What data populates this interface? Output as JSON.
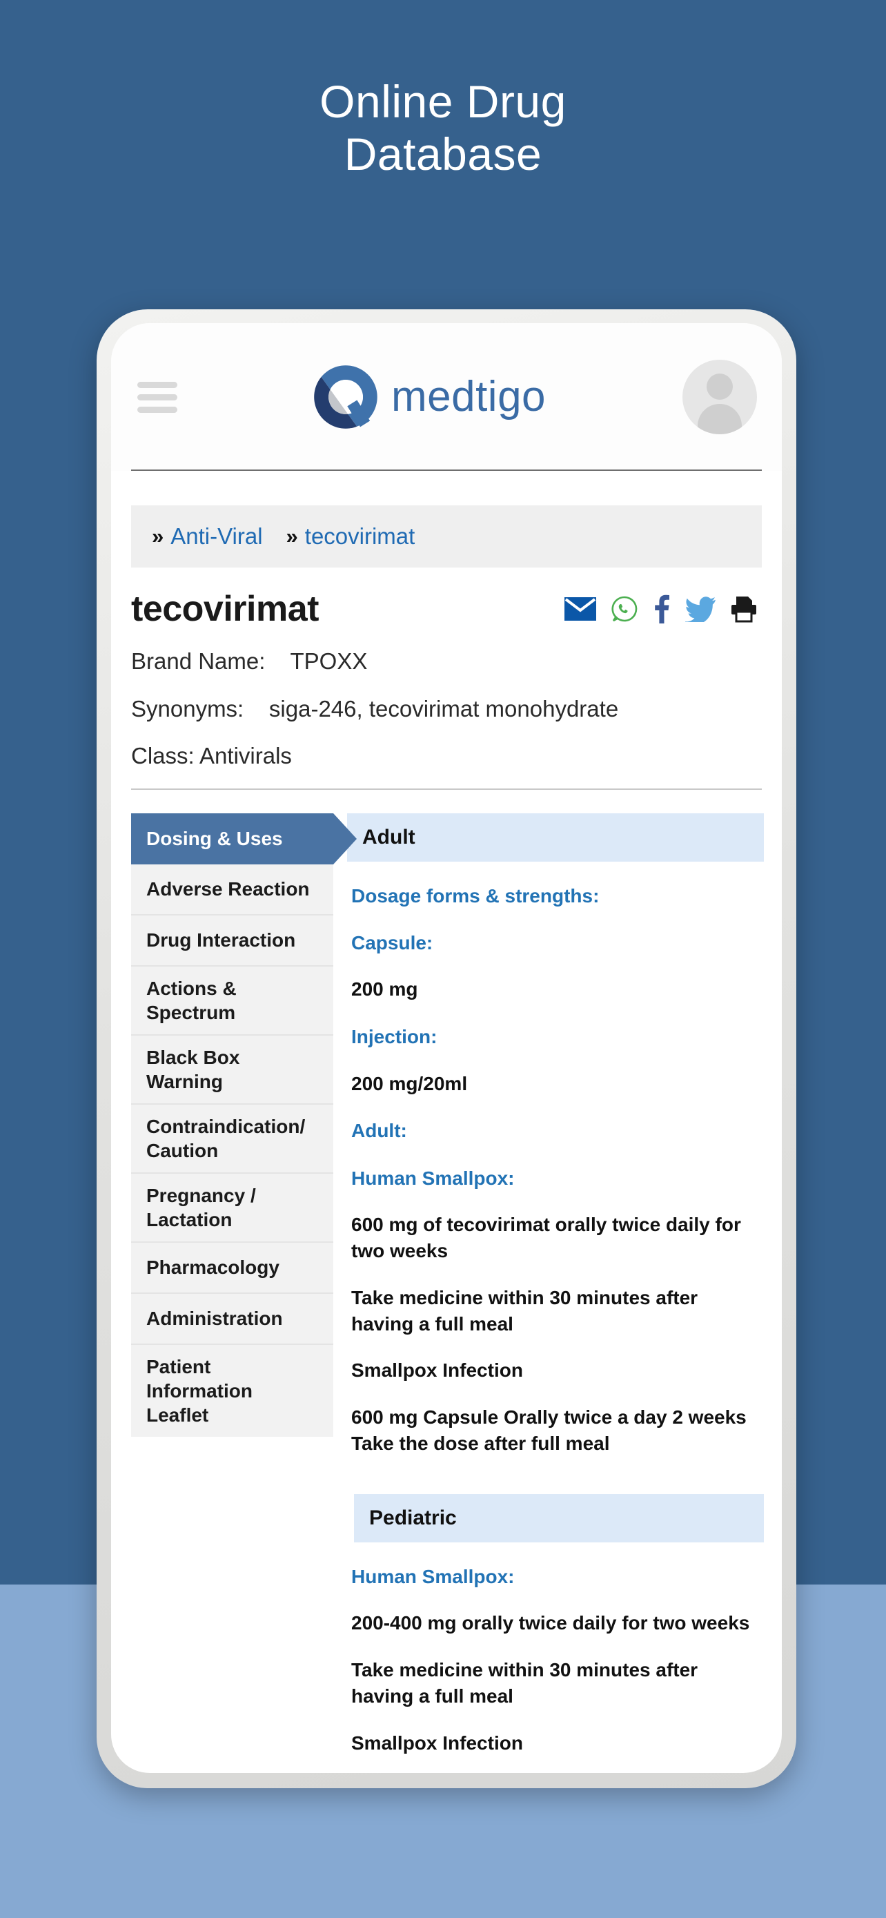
{
  "poster": {
    "title": "Online Drug\nDatabase",
    "bg_top_color": "#36618d",
    "bg_bottom_color": "#86a9d2"
  },
  "header": {
    "menu_icon": "hamburger-icon",
    "brand_name": "medtigo",
    "avatar_icon": "user-avatar-icon"
  },
  "breadcrumb": {
    "separator": "»",
    "items": [
      {
        "label": "Anti-Viral"
      },
      {
        "label": "tecovirimat"
      }
    ]
  },
  "drug": {
    "name": "tecovirimat",
    "brand_name_label": "Brand Name:",
    "brand_name_value": "TPOXX",
    "synonyms_label": "Synonyms:",
    "synonyms_value": "siga-246, tecovirimat monohydrate",
    "class_line": "Class: Antivirals"
  },
  "share": {
    "icons": [
      {
        "name": "email-icon",
        "color": "#0b57a8"
      },
      {
        "name": "whatsapp-icon",
        "color": "#4caf50"
      },
      {
        "name": "facebook-icon",
        "color": "#3b5998"
      },
      {
        "name": "twitter-icon",
        "color": "#5ba8e0"
      },
      {
        "name": "print-icon",
        "color": "#1a1a1a"
      }
    ]
  },
  "tabs": {
    "active_index": 0,
    "items": [
      {
        "label": "Dosing & Uses"
      },
      {
        "label": "Adverse Reaction"
      },
      {
        "label": "Drug Interaction"
      },
      {
        "label": "Actions & Spectrum"
      },
      {
        "label": "Black Box Warning"
      },
      {
        "label": "Contraindication/ Caution"
      },
      {
        "label": "Pregnancy / Lactation"
      },
      {
        "label": "Pharmacology"
      },
      {
        "label": "Administration"
      },
      {
        "label": "Patient Information Leaflet"
      }
    ]
  },
  "content": {
    "adult": {
      "heading": "Adult",
      "dosage_forms_heading": "Dosage forms & strengths:",
      "capsule_heading": "Capsule:",
      "capsule_value": "200 mg",
      "injection_heading": "Injection:",
      "injection_value": "200 mg/20ml",
      "adult_heading": "Adult:",
      "indication_heading": "Human Smallpox:",
      "dose_line_1": "600 mg of tecovirimat orally twice daily for two weeks",
      "dose_line_2": "Take medicine within 30 minutes after having a full meal",
      "condition": "Smallpox Infection",
      "condition_dose": "600 mg Capsule Orally  twice a day 2 weeks Take the dose after full meal"
    },
    "pediatric": {
      "heading": "Pediatric",
      "indication_heading": "Human Smallpox:",
      "dose_line_1": "200-400 mg orally twice daily for two weeks",
      "dose_line_2": "Take medicine within 30 minutes after having a full meal",
      "condition": "Smallpox Infection"
    }
  }
}
